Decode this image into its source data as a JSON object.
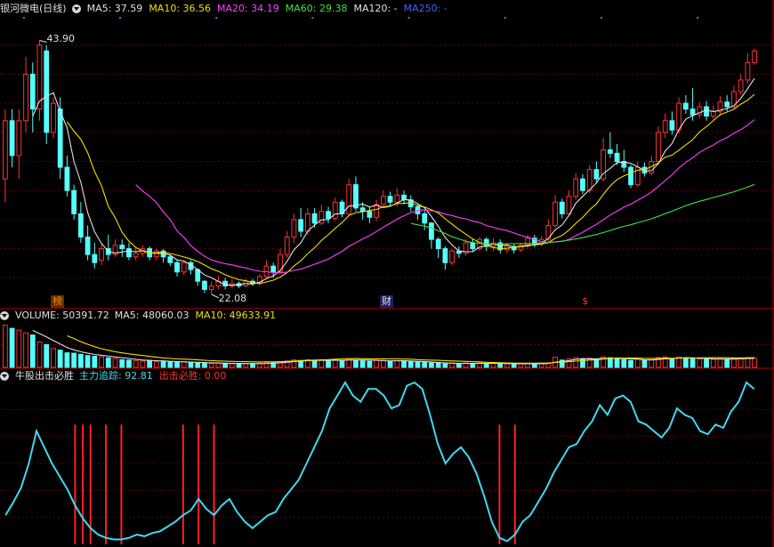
{
  "price_header": {
    "title": "银河微电(日线)",
    "items": [
      {
        "label": "MA5: 37.59",
        "color": "#e0e0e0"
      },
      {
        "label": "MA10: 36.56",
        "color": "#f0e000"
      },
      {
        "label": "MA20: 34.19",
        "color": "#ff40ff"
      },
      {
        "label": "MA60: 29.38",
        "color": "#40e040"
      },
      {
        "label": "MA120: -",
        "color": "#e0e0e0"
      },
      {
        "label": "MA250: -",
        "color": "#4060ff"
      }
    ]
  },
  "volume_header": {
    "title": "VOLUME: 50391.72",
    "items": [
      {
        "label": "MA5: 48060.03",
        "color": "#e0e0e0"
      },
      {
        "label": "MA10: 49633.91",
        "color": "#f0e000"
      }
    ]
  },
  "indicator_header": {
    "title": "牛股出击必胜",
    "items": [
      {
        "label": "主力追踪: 92.81",
        "color": "#40d8f0"
      },
      {
        "label": "出击必胜: 0.00",
        "color": "#ff3030"
      }
    ]
  },
  "annotations": {
    "high_label": "43.90",
    "low_label": "22.08",
    "markers": [
      {
        "text": "榜",
        "color": "#ff8000",
        "bg": "#603000"
      },
      {
        "text": "财",
        "color": "#e0e0e0",
        "bg": "#202060"
      },
      {
        "text": "$",
        "color": "#ff3030",
        "bg": "transparent"
      }
    ]
  },
  "chart_data": [
    {
      "type": "candlestick",
      "title": "银河微电(日线)",
      "ylim": [
        21,
        46
      ],
      "high": 43.9,
      "low": 22.08,
      "candles": [
        [
          32,
          37,
          30,
          38
        ],
        [
          37,
          34,
          33,
          38
        ],
        [
          34,
          37,
          32,
          38
        ],
        [
          37,
          41,
          36,
          42.5
        ],
        [
          41,
          38,
          36,
          42
        ],
        [
          38,
          43.5,
          37,
          43.9
        ],
        [
          43,
          36,
          35,
          43.5
        ],
        [
          36,
          38.5,
          35.5,
          39
        ],
        [
          38,
          33,
          32,
          39
        ],
        [
          33,
          31,
          30.5,
          34
        ],
        [
          31,
          29,
          28.5,
          31.5
        ],
        [
          29,
          27,
          26.5,
          30
        ],
        [
          27,
          25.5,
          25,
          28
        ],
        [
          25.5,
          24.8,
          24.3,
          26.5
        ],
        [
          25,
          26,
          24.6,
          26.5
        ],
        [
          26,
          25.5,
          25,
          27.2
        ],
        [
          25.5,
          26.3,
          25.3,
          26.8
        ],
        [
          26.3,
          26,
          25.3,
          26.8
        ],
        [
          26,
          25.3,
          25,
          26.5
        ],
        [
          25.3,
          25.6,
          25,
          26.1
        ],
        [
          25.6,
          26,
          25.3,
          26.3
        ],
        [
          26,
          25.3,
          25,
          26.2
        ],
        [
          25.3,
          25.8,
          25,
          26
        ],
        [
          25.8,
          25.3,
          24.8,
          26
        ],
        [
          25.3,
          24.8,
          24.5,
          25.5
        ],
        [
          24.8,
          24,
          23.6,
          25
        ],
        [
          24,
          24.8,
          23.7,
          25
        ],
        [
          24.8,
          24.2,
          23.8,
          25
        ],
        [
          24.2,
          23.2,
          22.8,
          24.3
        ],
        [
          23.2,
          22.5,
          22.2,
          23.3
        ],
        [
          22.5,
          22.8,
          22.08,
          23.2
        ],
        [
          22.8,
          23.2,
          22.5,
          23.7
        ],
        [
          23.2,
          22.8,
          22.5,
          23.5
        ],
        [
          22.8,
          23,
          22.6,
          23.4
        ],
        [
          23,
          22.8,
          22.6,
          23.2
        ],
        [
          22.8,
          23.2,
          22.7,
          23.4
        ],
        [
          23.2,
          23,
          22.8,
          23.4
        ],
        [
          23,
          23.6,
          22.8,
          23.8
        ],
        [
          23.6,
          24.5,
          23.4,
          25
        ],
        [
          24.5,
          24,
          23.5,
          24.8
        ],
        [
          24,
          25.5,
          23.9,
          26
        ],
        [
          25.5,
          27,
          25.2,
          27.5
        ],
        [
          27,
          28.5,
          26.5,
          29
        ],
        [
          28.5,
          27.5,
          27,
          29.5
        ],
        [
          27.5,
          29,
          27.2,
          29.5
        ],
        [
          29,
          28.2,
          27.8,
          29.5
        ],
        [
          28.2,
          29.2,
          28,
          29.8
        ],
        [
          29.2,
          28.6,
          28.2,
          29.6
        ],
        [
          28.6,
          30,
          28.4,
          30.4
        ],
        [
          30,
          29,
          28.7,
          30.2
        ],
        [
          29,
          31.5,
          28.8,
          32
        ],
        [
          31.5,
          29.5,
          29.2,
          32.2
        ],
        [
          29.5,
          29.2,
          28.5,
          30
        ],
        [
          29.2,
          28.7,
          28.2,
          29.6
        ],
        [
          28.7,
          29.8,
          28.4,
          30.2
        ],
        [
          29.8,
          30.5,
          29.5,
          31
        ],
        [
          30.5,
          30,
          29.7,
          30.9
        ],
        [
          30,
          30.6,
          29.6,
          31.2
        ],
        [
          30.6,
          30.2,
          29.8,
          31
        ],
        [
          30.2,
          29.6,
          29.2,
          30.6
        ],
        [
          29.6,
          29,
          28.5,
          29.8
        ],
        [
          29,
          28.2,
          27.6,
          29.3
        ],
        [
          28.2,
          26.8,
          26,
          28.3
        ],
        [
          26.8,
          26,
          25.2,
          27
        ],
        [
          26,
          24.8,
          24.2,
          26.2
        ],
        [
          24.8,
          25.8,
          24.6,
          26
        ],
        [
          25.8,
          25.6,
          25.2,
          26.2
        ],
        [
          25.6,
          26.5,
          25.4,
          26.8
        ],
        [
          26.5,
          26,
          25.7,
          26.9
        ],
        [
          26,
          26.8,
          25.8,
          27
        ],
        [
          26.8,
          26.2,
          25.8,
          27
        ],
        [
          26.2,
          26.5,
          25.8,
          26.9
        ],
        [
          26.5,
          25.9,
          25.6,
          26.8
        ],
        [
          25.9,
          26.2,
          25.6,
          26.5
        ],
        [
          26.2,
          25.9,
          25.6,
          26.4
        ],
        [
          25.9,
          26.3,
          25.7,
          26.5
        ],
        [
          26.3,
          26.9,
          26,
          27.2
        ],
        [
          26.9,
          26.4,
          26.1,
          27.2
        ],
        [
          26.4,
          26.8,
          26.2,
          27.1
        ],
        [
          26.8,
          28,
          26.6,
          28.5
        ],
        [
          28,
          30,
          27.8,
          30.6
        ],
        [
          30,
          29,
          28.6,
          30.3
        ],
        [
          29,
          30.5,
          28.8,
          31
        ],
        [
          30.5,
          32,
          30.2,
          32.5
        ],
        [
          32,
          31,
          30.7,
          32.4
        ],
        [
          31,
          32.8,
          30.8,
          33.2
        ],
        [
          32.8,
          32,
          31.6,
          33.5
        ],
        [
          32,
          34.5,
          31.8,
          35.5
        ],
        [
          34.5,
          34.2,
          33.8,
          36
        ],
        [
          34.2,
          33.5,
          33.2,
          35
        ],
        [
          33.5,
          33,
          32.6,
          34.5
        ],
        [
          33,
          31.5,
          31.2,
          33.2
        ],
        [
          31.5,
          33,
          31.3,
          33.5
        ],
        [
          33,
          32.5,
          32.2,
          33.4
        ],
        [
          32.5,
          33.5,
          32.3,
          34
        ],
        [
          33.5,
          36,
          33.2,
          36.5
        ],
        [
          36,
          37,
          35.5,
          37.6
        ],
        [
          37,
          36.2,
          35.8,
          37.8
        ],
        [
          36.2,
          38.5,
          35.9,
          39
        ],
        [
          38.5,
          38,
          37.6,
          39.2
        ],
        [
          38,
          37.5,
          37,
          39.8
        ],
        [
          37.5,
          38.2,
          37.2,
          38.6
        ],
        [
          38.2,
          37.4,
          37,
          38.7
        ],
        [
          37.4,
          37.8,
          37.1,
          38.3
        ],
        [
          37.8,
          38.6,
          37.5,
          39.1
        ],
        [
          38.6,
          38.2,
          37.8,
          39.2
        ],
        [
          38.2,
          39.5,
          38,
          40
        ],
        [
          39.5,
          40.5,
          39.2,
          41
        ],
        [
          40.5,
          42,
          40.2,
          42.8
        ],
        [
          42,
          43,
          41.8,
          43.2
        ]
      ]
    },
    {
      "type": "bar",
      "title": "VOLUME: 50391.72",
      "ylim": [
        0,
        250000
      ],
      "values": [
        232000,
        215000,
        205000,
        190000,
        178000,
        140000,
        125000,
        104000,
        95000,
        80000,
        78000,
        72000,
        65000,
        61000,
        58000,
        52000,
        48000,
        42000,
        40000,
        38000,
        34000,
        38000,
        31000,
        35000,
        29000,
        27000,
        31000,
        26000,
        24000,
        22000,
        21000,
        23000,
        22000,
        20000,
        21000,
        19000,
        21000,
        23000,
        27000,
        25000,
        30000,
        35000,
        41000,
        38000,
        42000,
        36000,
        40000,
        34000,
        44000,
        36000,
        48000,
        39000,
        35000,
        33000,
        38000,
        39000,
        34000,
        37000,
        33000,
        31000,
        29000,
        27000,
        24000,
        22000,
        20000,
        23000,
        21000,
        24000,
        21000,
        23000,
        21000,
        22000,
        20000,
        19000,
        18000,
        19000,
        22000,
        19000,
        21000,
        24000,
        56000,
        40000,
        46000,
        53000,
        44000,
        50000,
        43000,
        58000,
        53000,
        45000,
        42000,
        38000,
        44000,
        38000,
        42000,
        54000,
        58000,
        48000,
        56000,
        51000,
        49000,
        47000,
        45000,
        44000,
        47000,
        45000,
        48000,
        50000,
        52000,
        50000
      ],
      "ma5": [
        null,
        null,
        null,
        null,
        204000,
        185600,
        167600,
        147400,
        128400,
        108800,
        96400,
        85800,
        78000,
        71200,
        66800,
        61600,
        56800,
        52800,
        49000,
        44000,
        40400,
        38400,
        36200,
        35200,
        33400,
        32000,
        30600,
        29600,
        27400,
        26000,
        24800,
        24200,
        23200,
        22000,
        21400,
        21000,
        20600,
        20800,
        21200,
        23000,
        25200,
        28000,
        31600,
        33800,
        37200,
        38400,
        39400,
        38000,
        39200,
        38000,
        40400,
        40200,
        40400,
        39600,
        38600,
        36800,
        35800,
        36400,
        36200,
        34800,
        32800,
        31600,
        28800,
        26600,
        24400,
        23200,
        22000,
        22000,
        21800,
        22400,
        22000,
        22200,
        21800,
        21000,
        20600,
        19600,
        19600,
        19400,
        19800,
        21000,
        28400,
        32000,
        37400,
        43800,
        47800,
        47200,
        47200,
        49600,
        49600,
        48600,
        48200,
        47200,
        45600,
        41400,
        40800,
        43200,
        47200,
        48000,
        51600,
        53400,
        52400,
        50200,
        49600,
        47200,
        46000,
        45600,
        45800,
        46800,
        48400,
        49000
      ],
      "ma10": [
        null,
        null,
        null,
        null,
        null,
        null,
        null,
        null,
        null,
        173800,
        158600,
        141300,
        127200,
        114000,
        102300,
        94000,
        86300,
        80100,
        74600,
        69600,
        65200,
        60400,
        55700,
        52100,
        49100,
        46800,
        45100,
        43500,
        41000,
        38800,
        36800,
        35300,
        34400,
        32900,
        32100,
        31300,
        30300,
        30000,
        30300,
        30600,
        31500,
        32700,
        34600,
        36400,
        38500,
        40200,
        41500,
        42600,
        45000,
        46100,
        47900,
        48300,
        47700,
        47200,
        46800,
        47100,
        46500,
        46800,
        45700,
        45200,
        42100,
        40900,
        39800,
        38700,
        36900,
        35300,
        34000,
        32700,
        31500,
        30400,
        27700,
        27200,
        25700,
        24300,
        23500,
        23200,
        23200,
        23100,
        23300,
        23600,
        27200,
        29100,
        31300,
        34300,
        36900,
        40000,
        42100,
        45500,
        48700,
        50800,
        51400,
        51200,
        51000,
        49500,
        49300,
        49700,
        51000,
        50000,
        50300,
        50900,
        51600,
        52500,
        52600,
        53200,
        53700,
        52800,
        51800,
        52000,
        52700,
        52900
      ]
    },
    {
      "type": "line",
      "title": "牛股出击必胜",
      "ylim": [
        0,
        100
      ],
      "series": [
        {
          "name": "主力追踪",
          "values": [
            18,
            26,
            35,
            50,
            70,
            60,
            50,
            42,
            34,
            24,
            16,
            10,
            6,
            4,
            3,
            3,
            4,
            6,
            5,
            7,
            8,
            11,
            14,
            18,
            21,
            28,
            22,
            18,
            24,
            28,
            20,
            14,
            10,
            14,
            18,
            20,
            28,
            34,
            40,
            50,
            60,
            70,
            84,
            92,
            100,
            92,
            88,
            96,
            96,
            92,
            84,
            86,
            98,
            100,
            96,
            80,
            62,
            50,
            56,
            60,
            54,
            44,
            30,
            14,
            4,
            2,
            6,
            14,
            18,
            26,
            34,
            44,
            52,
            60,
            62,
            70,
            76,
            86,
            80,
            90,
            92,
            88,
            76,
            74,
            70,
            66,
            72,
            84,
            80,
            78,
            70,
            68,
            74,
            72,
            82,
            88,
            100,
            96
          ]
        },
        {
          "name": "出击必胜",
          "signals": [
            9,
            10,
            11,
            13,
            15,
            23,
            25,
            27,
            64,
            66
          ]
        }
      ]
    }
  ]
}
